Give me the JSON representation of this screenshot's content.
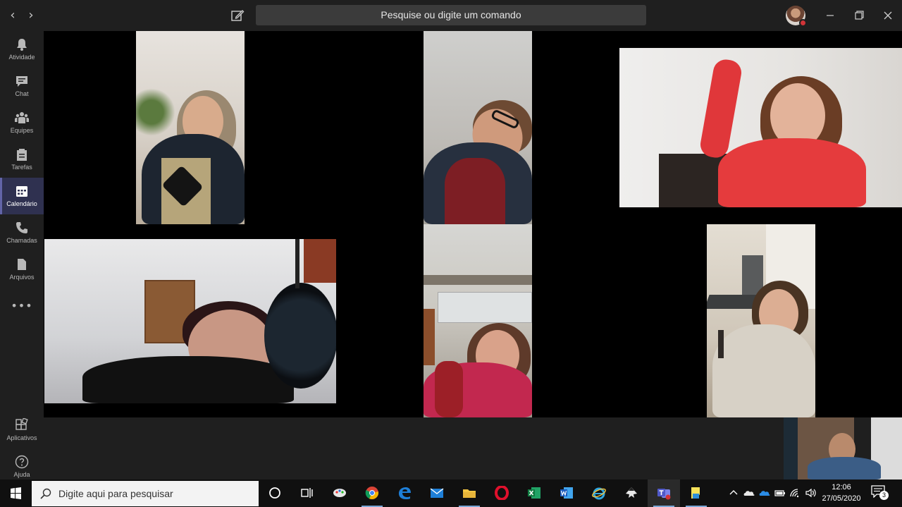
{
  "titlebar": {
    "search_placeholder": "Pesquise ou digite um comando"
  },
  "rail": {
    "items": [
      {
        "label": "Atividade",
        "icon": "bell-icon"
      },
      {
        "label": "Chat",
        "icon": "chat-icon"
      },
      {
        "label": "Equipes",
        "icon": "teams-icon"
      },
      {
        "label": "Tarefas",
        "icon": "tasks-icon"
      },
      {
        "label": "Calendário",
        "icon": "calendar-icon",
        "active": true
      },
      {
        "label": "Chamadas",
        "icon": "phone-icon"
      },
      {
        "label": "Arquivos",
        "icon": "files-icon"
      }
    ],
    "more": "•••",
    "bottom": [
      {
        "label": "Aplicativos",
        "icon": "apps-icon"
      },
      {
        "label": "Ajuda",
        "icon": "help-icon"
      }
    ]
  },
  "taskbar": {
    "search_placeholder": "Digite aqui para pesquisar",
    "apps": [
      "cortana-icon",
      "task-view-icon",
      "paint-icon",
      "chrome-icon",
      "edge-icon",
      "mail-icon",
      "file-explorer-icon",
      "opera-icon",
      "excel-icon",
      "word-icon",
      "internet-explorer-icon",
      "inkscape-icon",
      "teams-icon",
      "sticky-notes-icon"
    ],
    "time": "12:06",
    "date": "27/05/2020",
    "notification_count": "3"
  },
  "colors": {
    "rail_bg": "#1f1f1f",
    "active_item": "#2f3150",
    "accent": "#6264a7",
    "presence_busy": "#d13438"
  }
}
